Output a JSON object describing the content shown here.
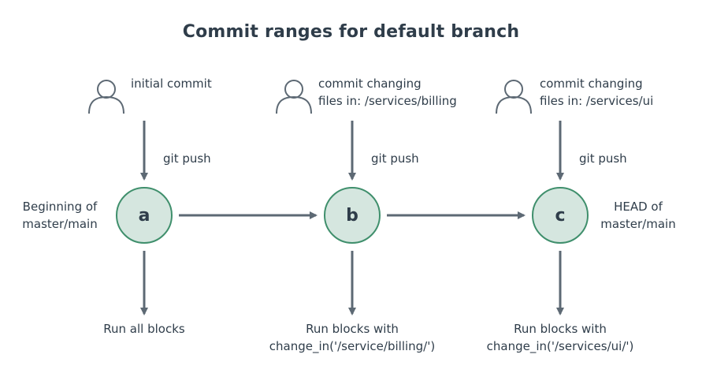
{
  "title": "Commit ranges for default branch",
  "colors": {
    "node_fill": "#d5e6df",
    "node_stroke": "#3f8f6c",
    "arrow": "#5d6974",
    "icon": "#5d6974",
    "text": "#2f3d4a"
  },
  "commits": [
    {
      "node": "a",
      "commit_lines": [
        "initial commit"
      ],
      "push_label": "git push",
      "side_lines": [
        "Beginning of",
        "master/main"
      ],
      "result_lines": [
        "Run all blocks"
      ]
    },
    {
      "node": "b",
      "commit_lines": [
        "commit changing",
        "files in: /services/billing"
      ],
      "push_label": "git push",
      "side_lines": [],
      "result_lines": [
        "Run blocks with",
        "change_in('/service/billing/')"
      ]
    },
    {
      "node": "c",
      "commit_lines": [
        "commit changing",
        "files in: /services/ui"
      ],
      "push_label": "git push",
      "side_lines": [
        "HEAD of",
        "master/main"
      ],
      "result_lines": [
        "Run blocks with",
        "change_in('/services/ui/')"
      ]
    }
  ]
}
